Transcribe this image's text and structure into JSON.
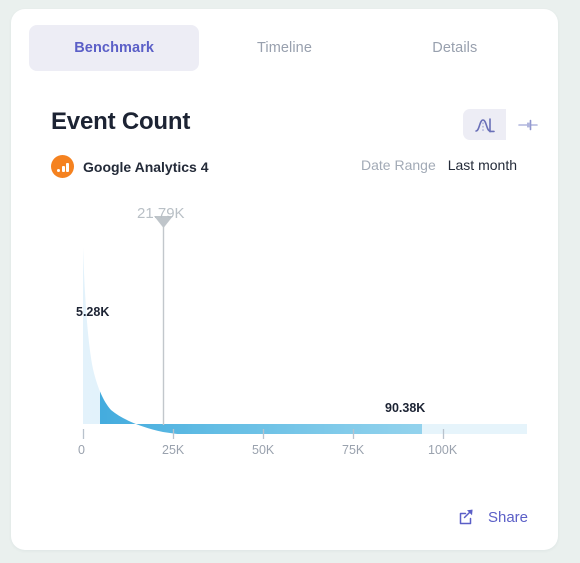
{
  "tabs": [
    {
      "label": "Benchmark",
      "active": true
    },
    {
      "label": "Timeline",
      "active": false
    },
    {
      "label": "Details",
      "active": false
    }
  ],
  "header": {
    "title": "Event Count",
    "source_name": "Google Analytics 4",
    "source_icon": "google-analytics-icon"
  },
  "view_toggle": {
    "options": [
      {
        "icon": "distribution-curve-icon",
        "active": true
      },
      {
        "icon": "box-plot-icon",
        "active": false
      }
    ]
  },
  "date_range": {
    "label": "Date Range",
    "value": "Last month"
  },
  "footer": {
    "share_label": "Share",
    "share_icon": "share-icon"
  },
  "colors": {
    "accent": "#5b5fc7",
    "active_tab_bg": "#ededf5",
    "source_orange": "#f58220",
    "area_dark": "#62bce4",
    "area_light": "#ddeffa",
    "marker_gray": "#b9c0c6",
    "page_bg": "#eaf0ee"
  },
  "chart_data": {
    "type": "area",
    "title": "Event Count",
    "xlabel": "",
    "ylabel": "",
    "xlim": [
      0,
      130000
    ],
    "ylim": [
      0,
      1
    ],
    "grid": false,
    "legend": null,
    "xticks": [
      "0",
      "25K",
      "50K",
      "75K",
      "100K"
    ],
    "xtick_values": [
      0,
      25000,
      50000,
      75000,
      100000
    ],
    "annotations": [
      {
        "name": "percentile-marker",
        "label": "21.79K",
        "value": 21790,
        "style": "gray-triangle-line"
      },
      {
        "name": "lower-bound",
        "label": "5.28K",
        "value": 5280,
        "style": "bold-dark"
      },
      {
        "name": "upper-bound",
        "label": "90.38K",
        "value": 90380,
        "style": "bold-dark"
      }
    ],
    "x": [
      0,
      1000,
      2500,
      5280,
      8000,
      12000,
      17000,
      21790,
      28000,
      36000,
      45000,
      55000,
      65000,
      75000,
      90380,
      105000,
      120000,
      130000
    ],
    "y": [
      0.985,
      0.94,
      0.8,
      0.635,
      0.46,
      0.345,
      0.275,
      0.235,
      0.195,
      0.16,
      0.135,
      0.115,
      0.1,
      0.088,
      0.072,
      0.055,
      0.04,
      0.03
    ],
    "highlight_range": [
      5280,
      90380
    ],
    "series": [
      {
        "name": "Event Count distribution",
        "values": [
          0.985,
          0.94,
          0.8,
          0.635,
          0.46,
          0.345,
          0.275,
          0.235,
          0.195,
          0.16,
          0.135,
          0.115,
          0.1,
          0.088,
          0.072,
          0.055,
          0.04,
          0.03
        ]
      }
    ]
  }
}
